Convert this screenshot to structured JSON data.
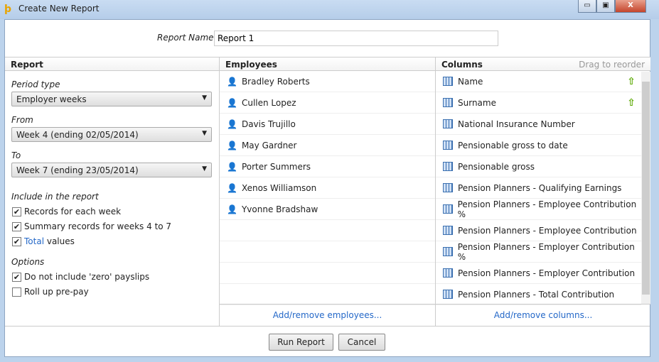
{
  "window": {
    "title": "Create New Report",
    "minimize": "▭",
    "maximize": "▣",
    "close": "X"
  },
  "report_name": {
    "label": "Report Name",
    "value": "Report 1"
  },
  "report": {
    "header": "Report",
    "period_label": "Period type",
    "period_value": "Employer weeks",
    "from_label": "From",
    "from_value": "Week 4 (ending 02/05/2014)",
    "to_label": "To",
    "to_value": "Week 7 (ending 23/05/2014)",
    "include_label": "Include in the report",
    "include": [
      {
        "label": "Records for each week",
        "checked": true
      },
      {
        "label": "Summary records for weeks 4 to 7",
        "checked": true
      }
    ],
    "total_link": "Total",
    "total_rest": " values",
    "total_checked": true,
    "options_label": "Options",
    "options": [
      {
        "label": "Do not include 'zero' payslips",
        "checked": true
      },
      {
        "label": "Roll up pre-pay",
        "checked": false
      }
    ]
  },
  "employees": {
    "header": "Employees",
    "items": [
      "Bradley Roberts",
      "Cullen Lopez",
      "Davis Trujillo",
      "May Gardner",
      "Porter Summers",
      "Xenos Williamson",
      "Yvonne Bradshaw"
    ],
    "link": "Add/remove employees..."
  },
  "columns": {
    "header": "Columns",
    "hint": "Drag to reorder",
    "items": [
      {
        "label": "Name",
        "sort": true
      },
      {
        "label": "Surname",
        "sort": true
      },
      {
        "label": "National Insurance Number"
      },
      {
        "label": "Pensionable gross to date"
      },
      {
        "label": "Pensionable gross"
      },
      {
        "label": "Pension Planners - Qualifying Earnings"
      },
      {
        "label": "Pension Planners - Employee Contribution %"
      },
      {
        "label": "Pension Planners - Employee Contribution"
      },
      {
        "label": "Pension Planners - Employer Contribution %"
      },
      {
        "label": "Pension Planners - Employer Contribution"
      },
      {
        "label": "Pension Planners - Total Contribution"
      }
    ],
    "link": "Add/remove columns..."
  },
  "buttons": {
    "run": "Run Report",
    "cancel": "Cancel"
  }
}
